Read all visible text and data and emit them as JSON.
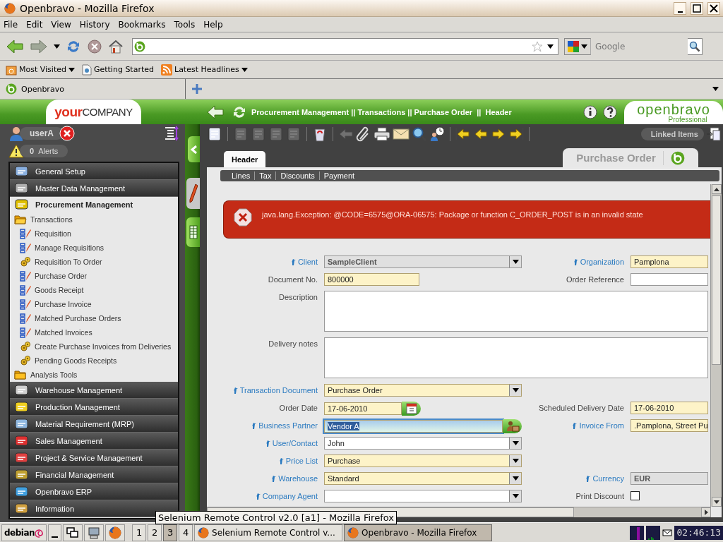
{
  "window": {
    "title": "Openbravo - Mozilla Firefox"
  },
  "menu_bar": [
    "File",
    "Edit",
    "View",
    "History",
    "Bookmarks",
    "Tools",
    "Help"
  ],
  "search": {
    "placeholder": "Google"
  },
  "bookmarks": [
    {
      "label": "Most Visited",
      "kind": "folder"
    },
    {
      "label": "Getting Started",
      "kind": "page"
    },
    {
      "label": "Latest Headlines",
      "kind": "feed"
    }
  ],
  "tabs": [
    {
      "label": "Openbravo",
      "selected": true
    }
  ],
  "app": {
    "logo": "**your**COMPANY",
    "breadcrumb": "Procurement Management || Transactions || Purchase Order  ||  Header",
    "brand": "openbravo",
    "edition": "Professional",
    "user": "userA",
    "alert_count": "0",
    "alert_label": "Alerts",
    "linked_items": "Linked Items",
    "window_tab": "Purchase Order",
    "error": "java.lang.Exception: @CODE=6575@ORA-06575: Package or function C_ORDER_POST is in an invalid state"
  },
  "doc_tabs": [
    {
      "label": "Header",
      "selected": true
    }
  ],
  "subtabs": [
    {
      "label": "Lines",
      "selected": false
    },
    {
      "label": "Tax",
      "selected": false
    },
    {
      "label": "Discounts",
      "selected": false
    },
    {
      "label": "Payment",
      "selected": false
    }
  ],
  "sidebar": {
    "items": [
      {
        "label": "General Setup",
        "expanded": false
      },
      {
        "label": "Master Data Management",
        "expanded": false
      },
      {
        "label": "Procurement Management",
        "expanded": true,
        "children": [
          {
            "label": "Transactions",
            "kind": "folder",
            "expanded": true,
            "children": [
              {
                "label": "Requisition",
                "kind": "window"
              },
              {
                "label": "Manage Requisitions",
                "kind": "window"
              },
              {
                "label": "Requisition To Order",
                "kind": "process"
              },
              {
                "label": "Purchase Order",
                "kind": "window"
              },
              {
                "label": "Goods Receipt",
                "kind": "window"
              },
              {
                "label": "Purchase Invoice",
                "kind": "window"
              },
              {
                "label": "Matched Purchase Orders",
                "kind": "window"
              },
              {
                "label": "Matched Invoices",
                "kind": "window"
              },
              {
                "label": "Create Purchase Invoices from Deliveries",
                "kind": "process"
              },
              {
                "label": "Pending Goods Receipts",
                "kind": "process"
              }
            ]
          },
          {
            "label": "Analysis Tools",
            "kind": "folder",
            "expanded": false
          }
        ]
      },
      {
        "label": "Warehouse Management",
        "expanded": false
      },
      {
        "label": "Production Management",
        "expanded": false
      },
      {
        "label": "Material Requirement (MRP)",
        "expanded": false
      },
      {
        "label": "Sales Management",
        "expanded": false
      },
      {
        "label": "Project & Service Management",
        "expanded": false
      },
      {
        "label": "Financial Management",
        "expanded": false
      },
      {
        "label": "Openbravo ERP",
        "expanded": false
      },
      {
        "label": "Information",
        "expanded": false
      }
    ]
  },
  "form": {
    "rows": [
      {
        "fields": [
          {
            "label": "Client",
            "link": true,
            "kind": "select",
            "required": false,
            "readonly": true,
            "focused": false,
            "value": "SampleClient"
          },
          {
            "label": "Organization",
            "link": true,
            "kind": "text",
            "required": true,
            "readonly": false,
            "focused": false,
            "value": "Pamplona"
          }
        ]
      },
      {
        "fields": [
          {
            "label": "Document No.",
            "link": false,
            "kind": "short",
            "required": true,
            "readonly": false,
            "focused": false,
            "value": "800000"
          },
          {
            "label": "Order Reference",
            "link": false,
            "kind": "text",
            "required": false,
            "readonly": false,
            "focused": false
          }
        ]
      },
      {
        "fields": [
          {
            "label": "Description",
            "link": false,
            "kind": "textarea",
            "required": false,
            "readonly": false,
            "focused": false
          }
        ]
      },
      {
        "fields": [
          {
            "label": "Delivery notes",
            "link": false,
            "kind": "textarea",
            "required": false,
            "readonly": false,
            "focused": false
          }
        ]
      },
      {
        "fields": [
          {
            "label": "Transaction Document",
            "link": true,
            "kind": "select",
            "required": true,
            "readonly": false,
            "focused": false,
            "value": "Purchase Order"
          }
        ]
      },
      {
        "fields": [
          {
            "label": "Order Date",
            "link": false,
            "kind": "date",
            "required": true,
            "readonly": false,
            "focused": false,
            "value": "17-06-2010"
          },
          {
            "label": "Scheduled Delivery Date",
            "link": false,
            "kind": "text",
            "required": true,
            "readonly": false,
            "focused": false,
            "value": "17-06-2010"
          }
        ]
      },
      {
        "fields": [
          {
            "label": "Business Partner",
            "link": true,
            "kind": "search",
            "required": true,
            "readonly": false,
            "focused": true,
            "value": "Vendor A"
          },
          {
            "label": "Invoice From",
            "link": true,
            "kind": "text",
            "required": true,
            "readonly": false,
            "focused": false,
            "value": ".Pamplona, Street Pu"
          }
        ]
      },
      {
        "fields": [
          {
            "label": "User/Contact",
            "link": true,
            "kind": "select",
            "required": false,
            "readonly": false,
            "focused": false,
            "value": "John"
          }
        ]
      },
      {
        "fields": [
          {
            "label": "Price List",
            "link": true,
            "kind": "select",
            "required": true,
            "readonly": false,
            "focused": false,
            "value": "Purchase"
          }
        ]
      },
      {
        "fields": [
          {
            "label": "Warehouse",
            "link": true,
            "kind": "select",
            "required": true,
            "readonly": false,
            "focused": false,
            "value": "Standard"
          },
          {
            "label": "Currency",
            "link": true,
            "kind": "text",
            "required": false,
            "readonly": true,
            "focused": false,
            "value": "EUR"
          }
        ]
      },
      {
        "fields": [
          {
            "label": "Company Agent",
            "link": true,
            "kind": "select",
            "required": false,
            "readonly": false,
            "focused": false
          },
          {
            "label": "Print Discount",
            "link": false,
            "kind": "checkbox",
            "checked": false
          }
        ]
      }
    ]
  },
  "taskbar": {
    "start": "debian",
    "workspaces": [
      {
        "label": "1",
        "selected": false
      },
      {
        "label": "2",
        "selected": false
      },
      {
        "label": "3",
        "selected": true
      },
      {
        "label": "4",
        "selected": false
      }
    ],
    "tasks": [
      {
        "label": "Selenium Remote Control v...",
        "selected": false
      },
      {
        "label": "Openbravo - Mozilla Firefox",
        "selected": true
      }
    ],
    "clock": "02:46:13"
  },
  "tooltip": "Selenium Remote Control v2.0 [a1] - Mozilla Firefox"
}
